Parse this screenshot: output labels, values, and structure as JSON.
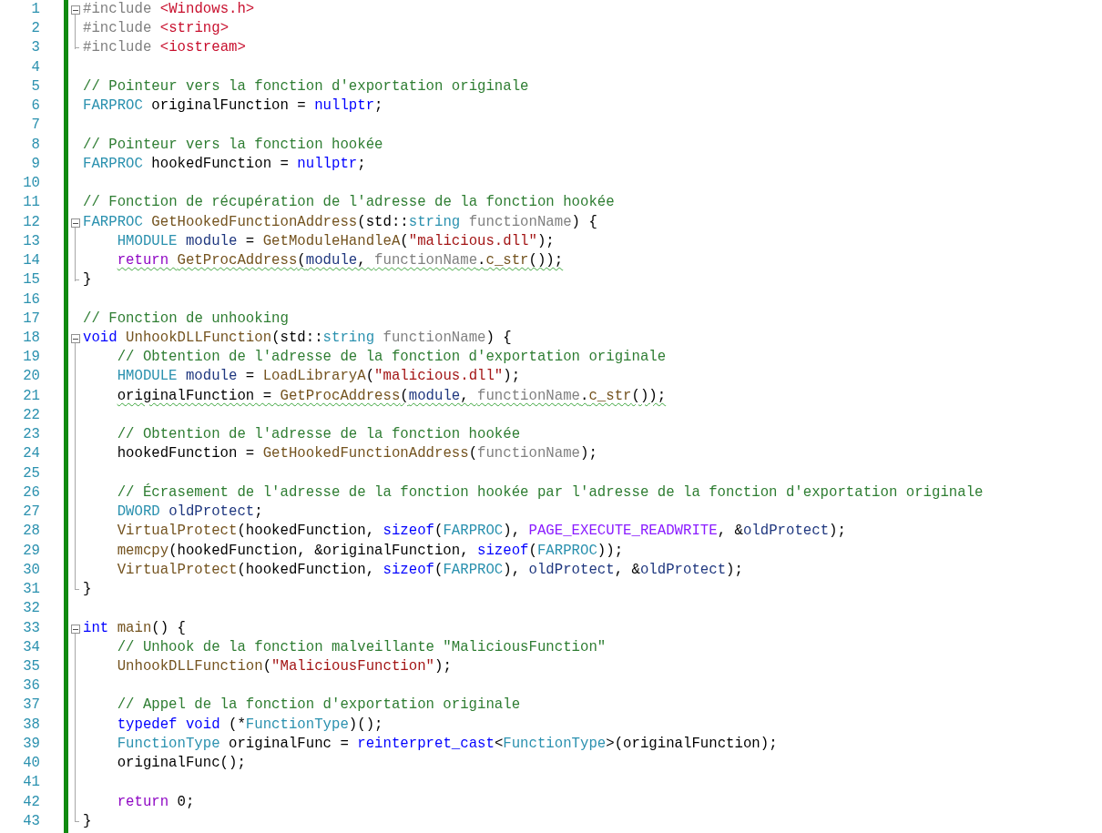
{
  "editor": {
    "lines": [
      {
        "number": "1",
        "kind": "start",
        "indented": false,
        "tokens": [
          {
            "kind": "pp",
            "text": "#include "
          },
          {
            "kind": "inc",
            "text": "<Windows.h>"
          }
        ]
      },
      {
        "number": "2",
        "kind": "body",
        "indented": false,
        "tokens": [
          {
            "kind": "pp",
            "text": "#include "
          },
          {
            "kind": "inc",
            "text": "<string>"
          }
        ]
      },
      {
        "number": "3",
        "kind": "end",
        "indented": false,
        "tokens": [
          {
            "kind": "pp",
            "text": "#include "
          },
          {
            "kind": "inc",
            "text": "<iostream>"
          }
        ]
      },
      {
        "number": "4",
        "kind": "plain"
      },
      {
        "number": "5",
        "kind": "plain",
        "indented": false,
        "tokens": [
          {
            "kind": "cm",
            "text": "// Pointeur vers la fonction d'exportation originale"
          }
        ]
      },
      {
        "number": "6",
        "kind": "plain",
        "indented": false,
        "tokens": [
          {
            "kind": "type",
            "text": "FARPROC "
          },
          {
            "kind": "p",
            "text": "originalFunction = "
          },
          {
            "kind": "kw",
            "text": "nullptr"
          },
          {
            "kind": "p",
            "text": ";"
          }
        ]
      },
      {
        "number": "7",
        "kind": "plain"
      },
      {
        "number": "8",
        "kind": "plain",
        "indented": false,
        "tokens": [
          {
            "kind": "cm",
            "text": "// Pointeur vers la fonction hookée"
          }
        ]
      },
      {
        "number": "9",
        "kind": "plain",
        "indented": false,
        "tokens": [
          {
            "kind": "type",
            "text": "FARPROC "
          },
          {
            "kind": "p",
            "text": "hookedFunction = "
          },
          {
            "kind": "kw",
            "text": "nullptr"
          },
          {
            "kind": "p",
            "text": ";"
          }
        ]
      },
      {
        "number": "10",
        "kind": "plain"
      },
      {
        "number": "11",
        "kind": "plain",
        "indented": false,
        "tokens": [
          {
            "kind": "cm",
            "text": "// Fonction de récupération de l'adresse de la fonction hookée"
          }
        ]
      },
      {
        "number": "12",
        "kind": "start",
        "indented": false,
        "tokens": [
          {
            "kind": "type",
            "text": "FARPROC "
          },
          {
            "kind": "fn",
            "text": "GetHookedFunctionAddress"
          },
          {
            "kind": "p",
            "text": "(std::"
          },
          {
            "kind": "type",
            "text": "string "
          },
          {
            "kind": "param",
            "text": "functionName"
          },
          {
            "kind": "p",
            "text": ") {"
          }
        ]
      },
      {
        "number": "13",
        "kind": "body",
        "indented": true,
        "tokens": [
          {
            "kind": "type",
            "text": "HMODULE "
          },
          {
            "kind": "var",
            "text": "module"
          },
          {
            "kind": "p",
            "text": " = "
          },
          {
            "kind": "fn",
            "text": "GetModuleHandleA"
          },
          {
            "kind": "p",
            "text": "("
          },
          {
            "kind": "str",
            "text": "\"malicious.dll\""
          },
          {
            "kind": "p",
            "text": ");"
          }
        ]
      },
      {
        "number": "14",
        "kind": "body",
        "indented": true,
        "squiggle": true,
        "tokens": [
          {
            "kind": "ctl",
            "text": "return "
          },
          {
            "kind": "fn",
            "text": "GetProcAddress"
          },
          {
            "kind": "p",
            "text": "("
          },
          {
            "kind": "var",
            "text": "module"
          },
          {
            "kind": "p",
            "text": ", "
          },
          {
            "kind": "param",
            "text": "functionName"
          },
          {
            "kind": "p",
            "text": "."
          },
          {
            "kind": "fn",
            "text": "c_str"
          },
          {
            "kind": "p",
            "text": "());"
          }
        ]
      },
      {
        "number": "15",
        "kind": "end",
        "indented": false,
        "tokens": [
          {
            "kind": "p",
            "text": "}"
          }
        ]
      },
      {
        "number": "16",
        "kind": "plain"
      },
      {
        "number": "17",
        "kind": "plain",
        "indented": false,
        "tokens": [
          {
            "kind": "cm",
            "text": "// Fonction de unhooking"
          }
        ]
      },
      {
        "number": "18",
        "kind": "start",
        "indented": false,
        "tokens": [
          {
            "kind": "kw",
            "text": "void "
          },
          {
            "kind": "fn",
            "text": "UnhookDLLFunction"
          },
          {
            "kind": "p",
            "text": "(std::"
          },
          {
            "kind": "type",
            "text": "string "
          },
          {
            "kind": "param",
            "text": "functionName"
          },
          {
            "kind": "p",
            "text": ") {"
          }
        ]
      },
      {
        "number": "19",
        "kind": "body",
        "indented": true,
        "tokens": [
          {
            "kind": "cm",
            "text": "// Obtention de l'adresse de la fonction d'exportation originale"
          }
        ]
      },
      {
        "number": "20",
        "kind": "body",
        "indented": true,
        "tokens": [
          {
            "kind": "type",
            "text": "HMODULE "
          },
          {
            "kind": "var",
            "text": "module"
          },
          {
            "kind": "p",
            "text": " = "
          },
          {
            "kind": "fn",
            "text": "LoadLibraryA"
          },
          {
            "kind": "p",
            "text": "("
          },
          {
            "kind": "str",
            "text": "\"malicious.dll\""
          },
          {
            "kind": "p",
            "text": ");"
          }
        ]
      },
      {
        "number": "21",
        "kind": "body",
        "indented": true,
        "squiggle": true,
        "tokens": [
          {
            "kind": "p",
            "text": "originalFunction = "
          },
          {
            "kind": "fn",
            "text": "GetProcAddress"
          },
          {
            "kind": "p",
            "text": "("
          },
          {
            "kind": "var",
            "text": "module"
          },
          {
            "kind": "p",
            "text": ", "
          },
          {
            "kind": "param",
            "text": "functionName"
          },
          {
            "kind": "p",
            "text": "."
          },
          {
            "kind": "fn",
            "text": "c_str"
          },
          {
            "kind": "p",
            "text": "());"
          }
        ]
      },
      {
        "number": "22",
        "kind": "body"
      },
      {
        "number": "23",
        "kind": "body",
        "indented": true,
        "tokens": [
          {
            "kind": "cm",
            "text": "// Obtention de l'adresse de la fonction hookée"
          }
        ]
      },
      {
        "number": "24",
        "kind": "body",
        "indented": true,
        "tokens": [
          {
            "kind": "p",
            "text": "hookedFunction = "
          },
          {
            "kind": "fn",
            "text": "GetHookedFunctionAddress"
          },
          {
            "kind": "p",
            "text": "("
          },
          {
            "kind": "param",
            "text": "functionName"
          },
          {
            "kind": "p",
            "text": ");"
          }
        ]
      },
      {
        "number": "25",
        "kind": "body"
      },
      {
        "number": "26",
        "kind": "body",
        "indented": true,
        "tokens": [
          {
            "kind": "cm",
            "text": "// Écrasement de l'adresse de la fonction hookée par l'adresse de la fonction d'exportation originale"
          }
        ]
      },
      {
        "number": "27",
        "kind": "body",
        "indented": true,
        "tokens": [
          {
            "kind": "type",
            "text": "DWORD "
          },
          {
            "kind": "var",
            "text": "oldProtect"
          },
          {
            "kind": "p",
            "text": ";"
          }
        ]
      },
      {
        "number": "28",
        "kind": "body",
        "indented": true,
        "tokens": [
          {
            "kind": "fn",
            "text": "VirtualProtect"
          },
          {
            "kind": "p",
            "text": "(hookedFunction, "
          },
          {
            "kind": "kw",
            "text": "sizeof"
          },
          {
            "kind": "p",
            "text": "("
          },
          {
            "kind": "type",
            "text": "FARPROC"
          },
          {
            "kind": "p",
            "text": "), "
          },
          {
            "kind": "macro",
            "text": "PAGE_EXECUTE_READWRITE"
          },
          {
            "kind": "p",
            "text": ", &"
          },
          {
            "kind": "var",
            "text": "oldProtect"
          },
          {
            "kind": "p",
            "text": ");"
          }
        ]
      },
      {
        "number": "29",
        "kind": "body",
        "indented": true,
        "tokens": [
          {
            "kind": "fn",
            "text": "memcpy"
          },
          {
            "kind": "p",
            "text": "(hookedFunction, &originalFunction, "
          },
          {
            "kind": "kw",
            "text": "sizeof"
          },
          {
            "kind": "p",
            "text": "("
          },
          {
            "kind": "type",
            "text": "FARPROC"
          },
          {
            "kind": "p",
            "text": "));"
          }
        ]
      },
      {
        "number": "30",
        "kind": "body",
        "indented": true,
        "tokens": [
          {
            "kind": "fn",
            "text": "VirtualProtect"
          },
          {
            "kind": "p",
            "text": "(hookedFunction, "
          },
          {
            "kind": "kw",
            "text": "sizeof"
          },
          {
            "kind": "p",
            "text": "("
          },
          {
            "kind": "type",
            "text": "FARPROC"
          },
          {
            "kind": "p",
            "text": "), "
          },
          {
            "kind": "var",
            "text": "oldProtect"
          },
          {
            "kind": "p",
            "text": ", &"
          },
          {
            "kind": "var",
            "text": "oldProtect"
          },
          {
            "kind": "p",
            "text": ");"
          }
        ]
      },
      {
        "number": "31",
        "kind": "end",
        "indented": false,
        "tokens": [
          {
            "kind": "p",
            "text": "}"
          }
        ]
      },
      {
        "number": "32",
        "kind": "plain"
      },
      {
        "number": "33",
        "kind": "start",
        "indented": false,
        "tokens": [
          {
            "kind": "kw",
            "text": "int "
          },
          {
            "kind": "fn",
            "text": "main"
          },
          {
            "kind": "p",
            "text": "() {"
          }
        ]
      },
      {
        "number": "34",
        "kind": "body",
        "indented": true,
        "tokens": [
          {
            "kind": "cm",
            "text": "// Unhook de la fonction malveillante \"MaliciousFunction\""
          }
        ]
      },
      {
        "number": "35",
        "kind": "body",
        "indented": true,
        "tokens": [
          {
            "kind": "fn",
            "text": "UnhookDLLFunction"
          },
          {
            "kind": "p",
            "text": "("
          },
          {
            "kind": "str",
            "text": "\"MaliciousFunction\""
          },
          {
            "kind": "p",
            "text": ");"
          }
        ]
      },
      {
        "number": "36",
        "kind": "body"
      },
      {
        "number": "37",
        "kind": "body",
        "indented": true,
        "tokens": [
          {
            "kind": "cm",
            "text": "// Appel de la fonction d'exportation originale"
          }
        ]
      },
      {
        "number": "38",
        "kind": "body",
        "indented": true,
        "tokens": [
          {
            "kind": "kw",
            "text": "typedef void "
          },
          {
            "kind": "p",
            "text": "(*"
          },
          {
            "kind": "type",
            "text": "FunctionType"
          },
          {
            "kind": "p",
            "text": ")();"
          }
        ]
      },
      {
        "number": "39",
        "kind": "body",
        "indented": true,
        "tokens": [
          {
            "kind": "type",
            "text": "FunctionType "
          },
          {
            "kind": "p",
            "text": "originalFunc = "
          },
          {
            "kind": "kw",
            "text": "reinterpret_cast"
          },
          {
            "kind": "p",
            "text": "<"
          },
          {
            "kind": "type",
            "text": "FunctionType"
          },
          {
            "kind": "p",
            "text": ">(originalFunction);"
          }
        ]
      },
      {
        "number": "40",
        "kind": "body",
        "indented": true,
        "tokens": [
          {
            "kind": "p",
            "text": "originalFunc();"
          }
        ]
      },
      {
        "number": "41",
        "kind": "body"
      },
      {
        "number": "42",
        "kind": "body",
        "indented": true,
        "tokens": [
          {
            "kind": "ctl",
            "text": "return "
          },
          {
            "kind": "p",
            "text": "0;"
          }
        ]
      },
      {
        "number": "43",
        "kind": "end",
        "indented": false,
        "tokens": [
          {
            "kind": "p",
            "text": "}"
          }
        ]
      }
    ]
  }
}
